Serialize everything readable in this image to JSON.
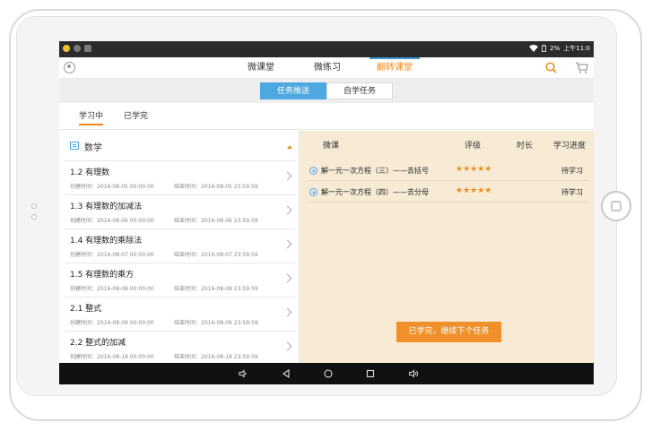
{
  "status_bar": {
    "battery": "2%",
    "time": "上午11:0"
  },
  "top_nav": {
    "tabs": [
      {
        "label": "微课堂"
      },
      {
        "label": "微练习"
      },
      {
        "label": "翻转课堂"
      }
    ],
    "active_tab": "翻转课堂"
  },
  "segments": {
    "items": [
      {
        "label": "任务推送"
      },
      {
        "label": "自学任务"
      }
    ],
    "active": "任务推送"
  },
  "status_tabs": {
    "items": [
      {
        "label": "学习中"
      },
      {
        "label": "已学完"
      }
    ],
    "active": "学习中"
  },
  "subject": {
    "title": "数学"
  },
  "lessons": [
    {
      "title": "1.2 有理数",
      "created": "创建时间：2016-08-05 00:00:00",
      "ended": "结束时间：2016-08-05 23:59:59"
    },
    {
      "title": "1.3  有理数的加减法",
      "created": "创建时间：2016-08-06 00:00:00",
      "ended": "结束时间：2016-08-06 23:59:59"
    },
    {
      "title": "1.4  有理数的乘除法",
      "created": "创建时间：2016-08-07 00:00:00",
      "ended": "结束时间：2016-08-07 23:59:59"
    },
    {
      "title": "1.5  有理数的乘方",
      "created": "创建时间：2016-08-08 00:00:00",
      "ended": "结束时间：2016-08-08 23:59:59"
    },
    {
      "title": "2.1  整式",
      "created": "创建时间：2016-08-09 00:00:00",
      "ended": "结束时间：2016-08-09 23:59:59"
    },
    {
      "title": "2.2  整式的加减",
      "created": "创建时间：2016-08-18 00:00:00",
      "ended": "结束时间：2016-08-18 23:59:59"
    }
  ],
  "course_table": {
    "headers": {
      "course": "微课",
      "rating": "评级",
      "duration": "时长",
      "progress": "学习进度"
    },
    "rows": [
      {
        "title": "解一元一次方程（三）——去括号",
        "stars": "★★★★★",
        "rating": 5,
        "duration": "",
        "status": "待学习"
      },
      {
        "title": "解一元一次方程（四）——去分母",
        "stars": "★★★★★",
        "rating": 5,
        "duration": "",
        "status": "待学习"
      }
    ]
  },
  "continue_button": {
    "label": "已学完，继续下个任务"
  },
  "colors": {
    "accent_orange": "#f08c1e",
    "accent_blue": "#4ea8e0",
    "right_panel_bg": "#f7ebd5"
  }
}
